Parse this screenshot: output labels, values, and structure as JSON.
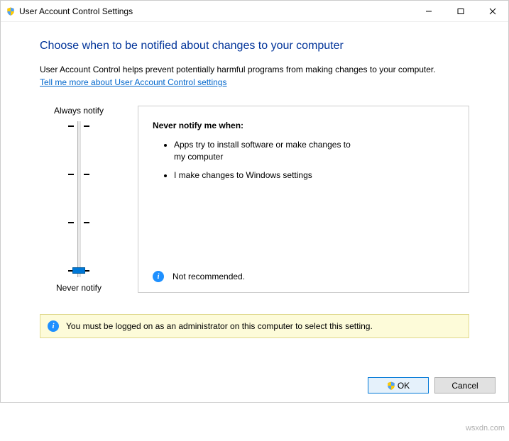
{
  "titlebar": {
    "title": "User Account Control Settings"
  },
  "main": {
    "heading": "Choose when to be notified about changes to your computer",
    "description": "User Account Control helps prevent potentially harmful programs from making changes to your computer.",
    "link_text": "Tell me more about User Account Control settings"
  },
  "slider": {
    "top_label": "Always notify",
    "bottom_label": "Never notify",
    "levels": 4,
    "current_level": 0
  },
  "info": {
    "title": "Never notify me when:",
    "items": [
      "Apps try to install software or make changes to my computer",
      "I make changes to Windows settings"
    ],
    "footer_text": "Not recommended."
  },
  "admin_notice": "You must be logged on as an administrator on this computer to select this setting.",
  "buttons": {
    "ok": "OK",
    "cancel": "Cancel"
  },
  "watermark": "wsxdn.com"
}
